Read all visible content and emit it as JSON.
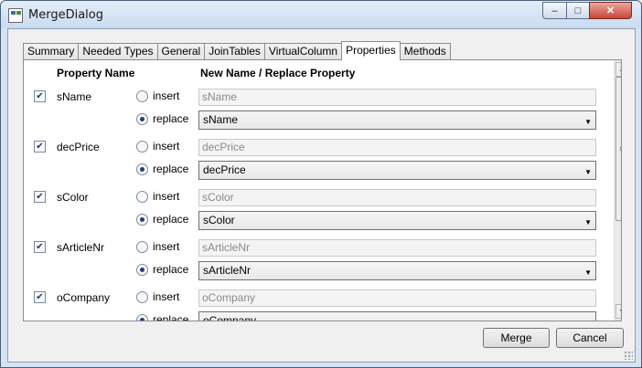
{
  "window": {
    "title": "MergeDialog",
    "icon": "app-window-icon",
    "controls": {
      "minimize": "‒",
      "maximize": "□",
      "close": "✕"
    }
  },
  "tabs": [
    {
      "label": "Summary",
      "active": false
    },
    {
      "label": "Needed Types",
      "active": false
    },
    {
      "label": "General",
      "active": false
    },
    {
      "label": "JoinTables",
      "active": false
    },
    {
      "label": "VirtualColumn",
      "active": false
    },
    {
      "label": "Properties",
      "active": true
    },
    {
      "label": "Methods",
      "active": false
    }
  ],
  "headers": {
    "property_name": "Property Name",
    "new_name": "New Name / Replace Property"
  },
  "radio_labels": {
    "insert": "insert",
    "replace": "replace"
  },
  "rows": [
    {
      "checked": true,
      "name": "sName",
      "mode": "replace",
      "insert_value": "sName",
      "replace_value": "sName"
    },
    {
      "checked": true,
      "name": "decPrice",
      "mode": "replace",
      "insert_value": "decPrice",
      "replace_value": "decPrice"
    },
    {
      "checked": true,
      "name": "sColor",
      "mode": "replace",
      "insert_value": "sColor",
      "replace_value": "sColor"
    },
    {
      "checked": true,
      "name": "sArticleNr",
      "mode": "replace",
      "insert_value": "sArticleNr",
      "replace_value": "sArticleNr"
    },
    {
      "checked": true,
      "name": "oCompany",
      "mode": "replace",
      "insert_value": "oCompany",
      "replace_value": "oCompany"
    }
  ],
  "buttons": {
    "merge": "Merge",
    "cancel": "Cancel"
  }
}
